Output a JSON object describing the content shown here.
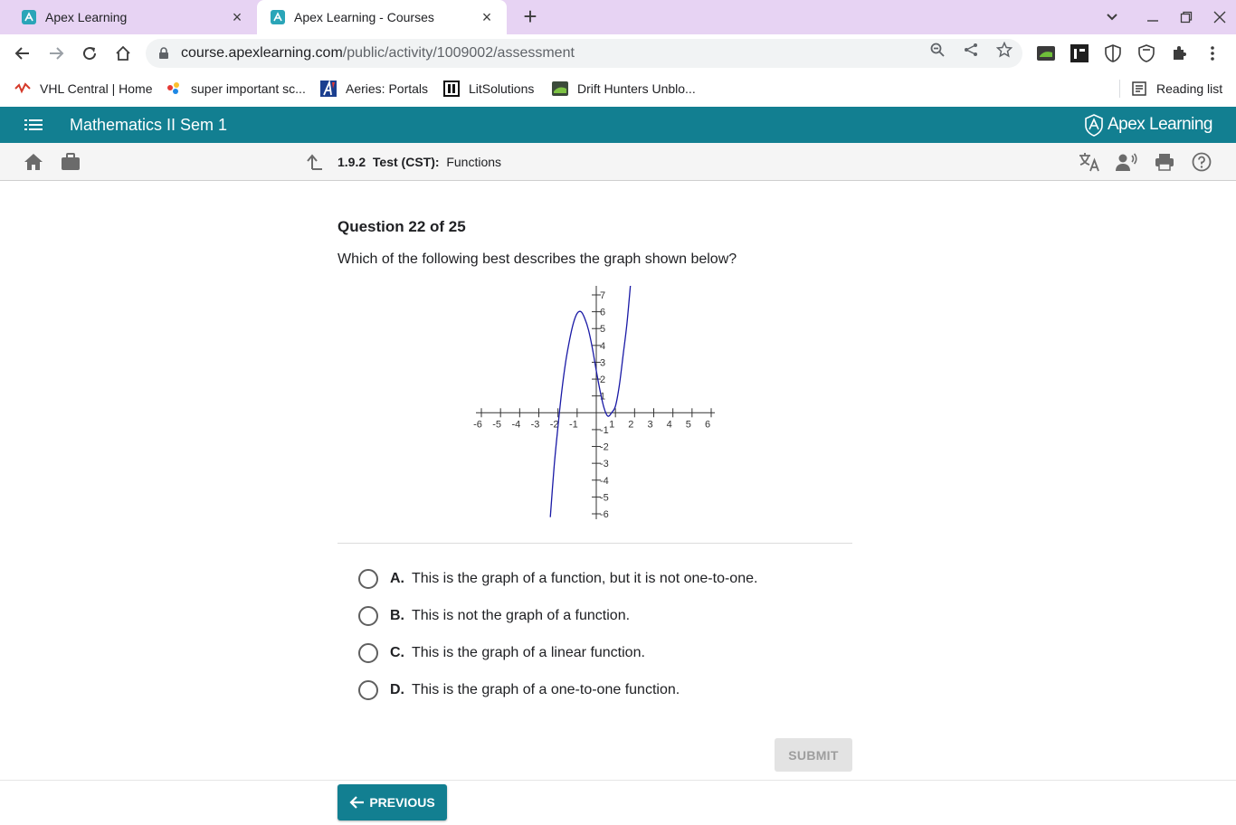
{
  "browser": {
    "tabs": [
      {
        "title": "Apex Learning",
        "favicon": "apex-favicon",
        "active": false
      },
      {
        "title": "Apex Learning - Courses",
        "favicon": "apex-favicon",
        "active": true
      }
    ],
    "address": {
      "host": "course.apexlearning.com",
      "path": "/public/activity/1009002/assessment"
    },
    "bookmarks": [
      {
        "label": "VHL Central | Home",
        "icon": "vhl-icon"
      },
      {
        "label": "super important sc...",
        "icon": "sparkle-icon"
      },
      {
        "label": "Aeries: Portals",
        "icon": "aeries-icon"
      },
      {
        "label": "LitSolutions",
        "icon": "lit-icon"
      },
      {
        "label": "Drift Hunters Unblo...",
        "icon": "game-icon"
      }
    ],
    "reading_list": "Reading list"
  },
  "app": {
    "course_title": "Mathematics II Sem 1",
    "brand": "Apex Learning",
    "brand_color": "#127f91",
    "breadcrumb": {
      "number": "1.9.2",
      "type": "Test (CST):",
      "title": "Functions"
    }
  },
  "question": {
    "header": "Question 22 of 25",
    "prompt": "Which of the following best describes the graph shown below?",
    "choices": [
      {
        "letter": "A.",
        "text": "This is the graph of a function, but it is not one-to-one."
      },
      {
        "letter": "B.",
        "text": "This is not the graph of a function."
      },
      {
        "letter": "C.",
        "text": "This is the graph of a linear function."
      },
      {
        "letter": "D.",
        "text": "This is the graph of a one-to-one function."
      }
    ],
    "submit_label": "SUBMIT"
  },
  "navigation": {
    "previous_label": "PREVIOUS"
  },
  "chart_data": {
    "type": "line",
    "title": "",
    "xlabel": "",
    "ylabel": "",
    "xlim": [
      -6,
      6
    ],
    "ylim": [
      -6,
      7
    ],
    "x_ticks": [
      -6,
      -5,
      -4,
      -3,
      -2,
      -1,
      1,
      2,
      3,
      4,
      5,
      6
    ],
    "y_ticks": [
      -6,
      -5,
      -4,
      -3,
      -2,
      -1,
      1,
      2,
      3,
      4,
      5,
      6,
      7
    ],
    "grid": false,
    "series": [
      {
        "color": "#1a1aa6",
        "x": [
          -2.4,
          -2.2,
          -2.0,
          -1.8,
          -1.6,
          -1.4,
          -1.2,
          -1.0,
          -0.8,
          -0.6,
          -0.4,
          -0.2,
          0.0,
          0.2,
          0.4,
          0.6,
          0.8,
          1.0,
          1.2,
          1.4,
          1.6,
          1.8
        ],
        "y": [
          -6.2,
          -3.2,
          -0.8,
          1.3,
          3.0,
          4.3,
          5.3,
          5.9,
          6.0,
          5.6,
          4.9,
          3.8,
          2.5,
          1.3,
          0.3,
          -0.2,
          0.0,
          0.4,
          1.6,
          3.4,
          5.3,
          7.8
        ]
      }
    ]
  }
}
